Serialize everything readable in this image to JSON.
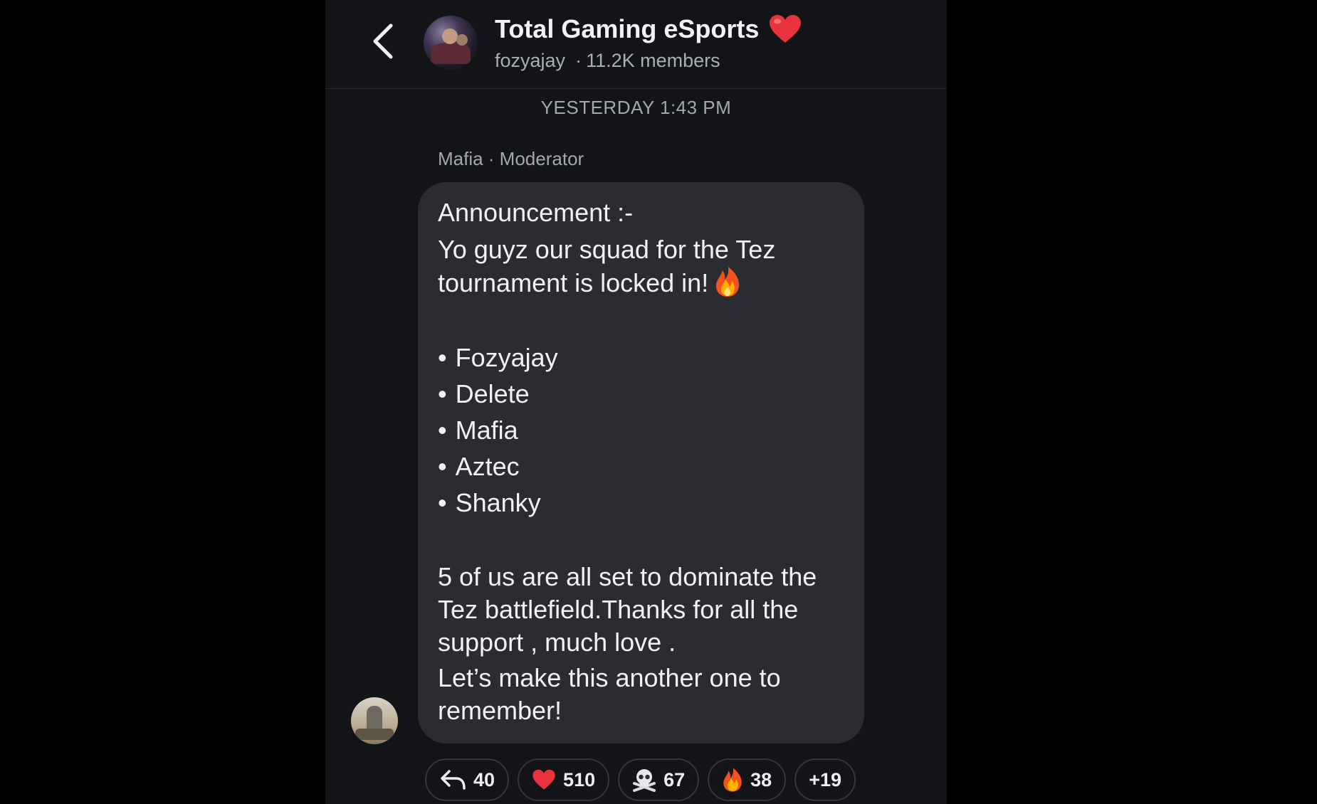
{
  "header": {
    "title": "Total Gaming eSports",
    "owner": "fozyajay",
    "members": "11.2K members",
    "heart_color": "#e8333d"
  },
  "chat": {
    "timestamp": "YESTERDAY 1:43 PM",
    "sender": "Mafia · Moderator",
    "message": {
      "line1": "Announcement :-",
      "line2": "Yo guyz our squad for the Tez tournament is locked in!",
      "squad": [
        "Fozyajay",
        "Delete",
        "Mafia",
        "Aztec",
        "Shanky"
      ],
      "bullet": "•",
      "line3": "5 of us are all set to dominate the Tez battlefield.Thanks for all the support , much love .",
      "line4": "Let’s make this another one to remember!"
    }
  },
  "reactions": {
    "replies": "40",
    "heart": "510",
    "skull": "67",
    "fire": "38",
    "more": "+19"
  }
}
